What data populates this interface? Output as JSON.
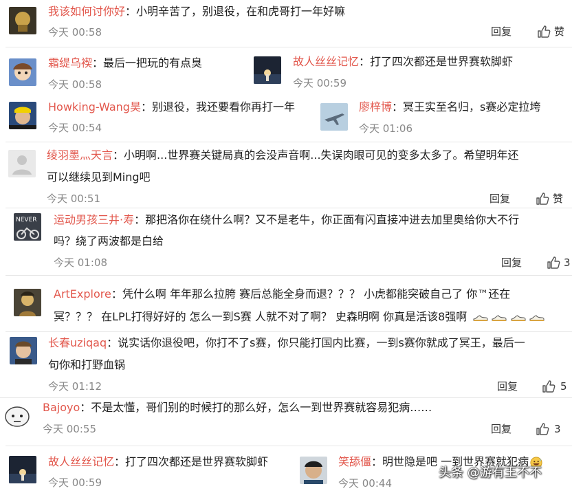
{
  "comments": [
    {
      "name": "我该如何讨你好",
      "text": "小明辛苦了，别退役，在和虎哥打一年好嘛",
      "time": "今天 00:58",
      "reply": "回复",
      "like": "赞"
    },
    {
      "name": "霜缇乌褉",
      "text": "最后一把玩的有点臭",
      "time": "今天 00:58"
    },
    {
      "name": "故人丝丝记忆",
      "text": "打了四次都还是世界赛软脚虾",
      "time": "今天 00:59"
    },
    {
      "name": "Howking-Wang昊",
      "text": "别退役，我还要看你再打一年",
      "time": "今天 00:54"
    },
    {
      "name": "廖梓博",
      "text": "冥王实至名归，s赛必定拉垮",
      "time": "今天 01:06"
    },
    {
      "name": "绫羽墨灬天言",
      "text1": "小明啊...世界赛关键局真的会没声音啊...失误肉眼可见的变多太多了。希望明年还",
      "text2": "可以继续见到Ming吧",
      "time": "今天 00:51",
      "reply": "回复",
      "like": "赞"
    },
    {
      "name": "运动男孩三井·寿",
      "text1": "那把洛你在绕什么啊？又不是老牛，你正面有闪直接冲进去加里奥给你大不行",
      "text2": "吗？绕了两波都是白给",
      "time": "今天 01:08",
      "reply": "回复",
      "like_count": "3"
    },
    {
      "name": "ArtExplore",
      "text1": "凭什么啊 年年那么拉胯 赛后总能全身而退？？？ 小虎都能突破自己了 你™还在",
      "text2": "冥？？？ 在LPL打得好好的 怎么一到S赛 人就不对了啊？ 史森明啊 你真是活该8强啊"
    },
    {
      "name": "长春uziqaq",
      "text1": "说实话你退役吧，你打不了s赛，你只能打国内比赛，一到s赛你就成了冥王，最后一",
      "text2": "句你和打野血锅",
      "time": "今天 01:12",
      "reply": "回复",
      "like_count": "5"
    },
    {
      "name": "Bajoyo",
      "text": "不是太懂，哥们别的时候打的那么好，怎么一到世界赛就容易犯病……",
      "time": "今天 00:55",
      "reply": "回复",
      "like_count": "3"
    },
    {
      "name": "故人丝丝记忆",
      "text": "打了四次都还是世界赛软脚虾",
      "time": "今天 00:59"
    },
    {
      "name": "笑舔僵",
      "text": "明世隐是吧 一到世界赛就犯病",
      "time": "今天 00:44"
    }
  ],
  "watermark": "头条 @游有王不不",
  "colors": {
    "name": "#e2574c",
    "time": "#888888",
    "separator": "#e6e6e6"
  }
}
